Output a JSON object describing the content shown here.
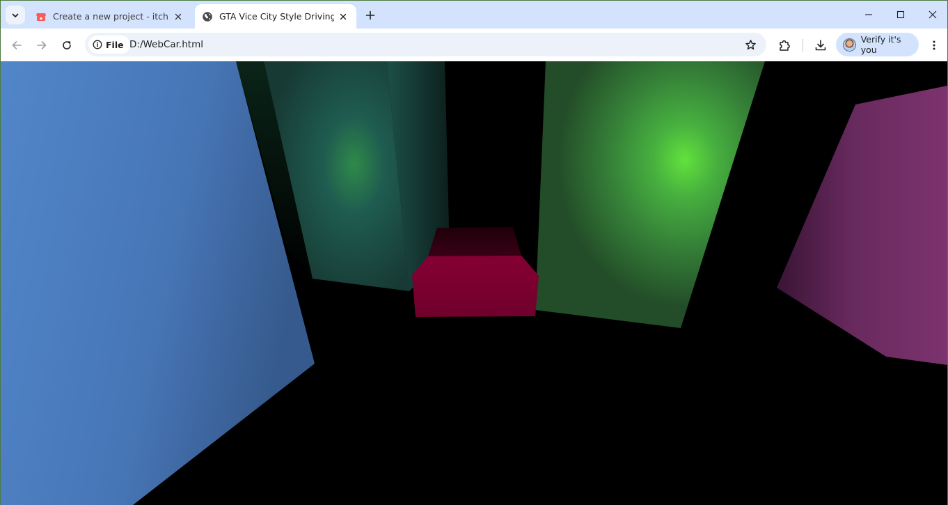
{
  "browser": {
    "tabs": [
      {
        "title": "Create a new project - itch.io",
        "favicon": "itchio-icon",
        "active": false
      },
      {
        "title": "GTA Vice City Style Driving Dem",
        "favicon": "globe-icon",
        "active": true
      }
    ],
    "address": {
      "scheme_chip": "File",
      "url": "D:/WebCar.html"
    },
    "profile_label": "Verify it's you"
  },
  "scene": {
    "colors": {
      "blue_building": "#4f82c4",
      "teal_building": "#1f5a50",
      "green_building": "#3a9a42",
      "green_light": "#5fe03c",
      "magenta_building": "#7a2e6a",
      "car_body": "#7a0030",
      "car_roof": "#2a0010",
      "ground": "#000000"
    }
  }
}
